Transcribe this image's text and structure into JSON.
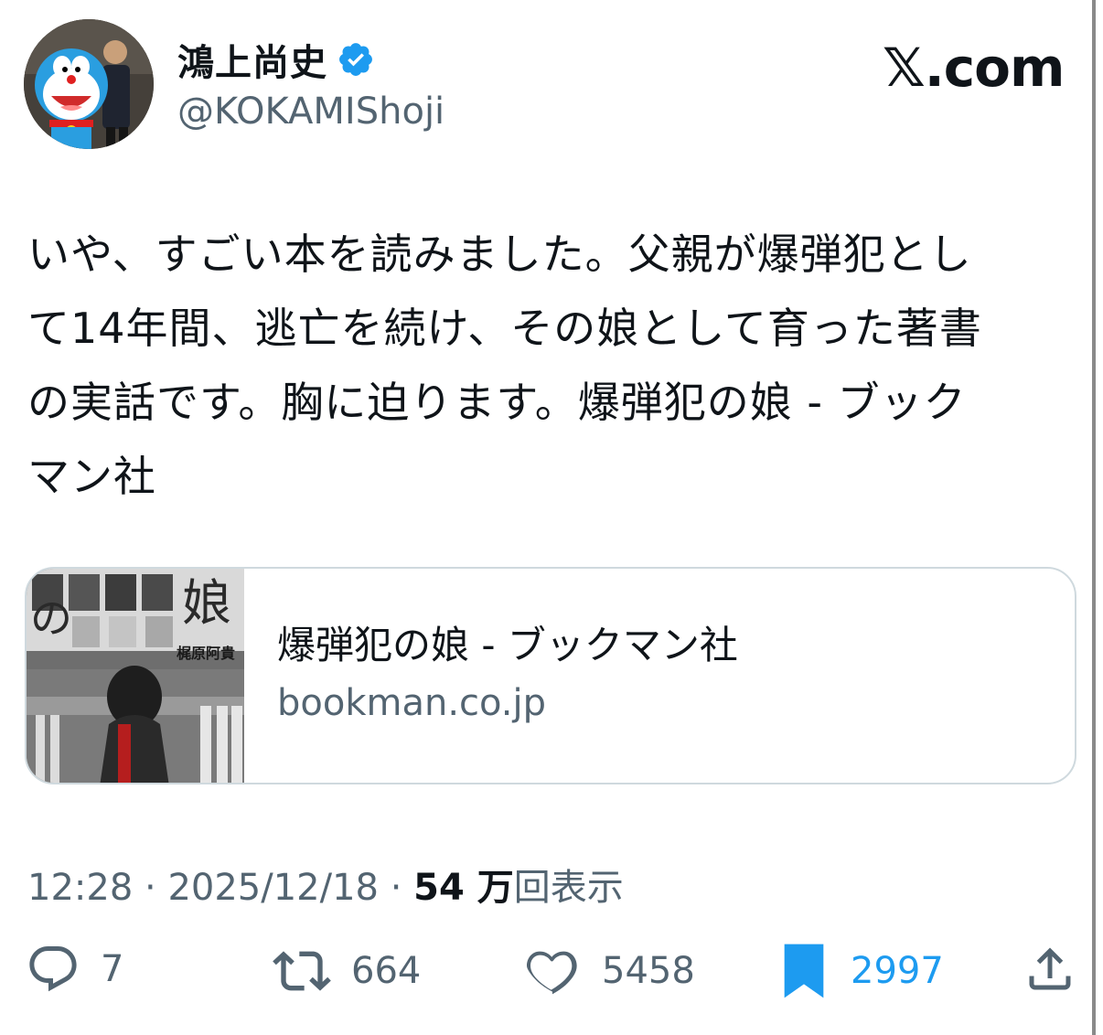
{
  "author": {
    "display_name": "鴻上尚史",
    "handle": "@KOKAMIShoji",
    "verified": true,
    "verified_color": "#1d9bf0"
  },
  "brand": {
    "label": "𝕏.com"
  },
  "tweet": {
    "lines": [
      "いや、すごい本を読みました。父親が爆弾犯とし",
      "て14年間、逃亡を続け、その娘として育った著書",
      "の実話です。胸に迫ります。爆弾犯の娘 - ブック",
      "マン社"
    ]
  },
  "link_card": {
    "title": "爆弾犯の娘 - ブックマン社",
    "domain": "bookman.co.jp",
    "cover_text": {
      "big_char_1": "の",
      "big_char_2": "娘",
      "author": "梶原阿貴"
    }
  },
  "meta": {
    "time": "12:28",
    "separator": "·",
    "date": "2025/12/18",
    "views_count": "54 万",
    "views_label": "回表示"
  },
  "actions": {
    "replies": "7",
    "retweets": "664",
    "likes": "5458",
    "bookmarks": "2997",
    "bookmark_active_color": "#1d9bf0",
    "icons": {
      "reply": "reply-icon",
      "retweet": "retweet-icon",
      "like": "heart-icon",
      "bookmark": "bookmark-icon",
      "share": "share-icon"
    }
  }
}
